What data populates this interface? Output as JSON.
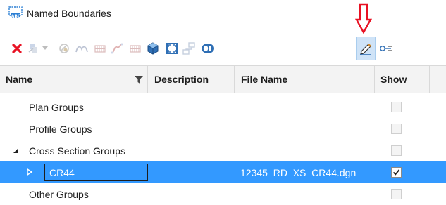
{
  "window": {
    "title": "Named Boundaries",
    "title_icon": "named-boundaries-icon"
  },
  "toolbar": {
    "buttons": [
      {
        "icon": "delete-x-icon",
        "enabled": true,
        "color": "#e81123"
      },
      {
        "icon": "design-stage-icon",
        "enabled": false
      },
      {
        "icon": "dropdown-arrow-icon",
        "enabled": false
      },
      {
        "icon": "clip-volume-icon",
        "enabled": false
      },
      {
        "icon": "profile-shape-icon",
        "enabled": false
      },
      {
        "icon": "grid-lines-icon",
        "enabled": false
      },
      {
        "icon": "curve-icon",
        "enabled": false
      },
      {
        "icon": "grid-lines-2-icon",
        "enabled": false
      },
      {
        "icon": "3d-cube-icon",
        "enabled": true
      },
      {
        "icon": "fit-view-icon",
        "enabled": true
      },
      {
        "icon": "group-hierarchy-icon",
        "enabled": false
      },
      {
        "icon": "properties-icon",
        "enabled": true
      },
      {
        "icon": "pencil-edit-icon",
        "enabled": true,
        "active": true
      },
      {
        "icon": "key-settings-icon",
        "enabled": true
      }
    ],
    "annotation_arrow_color": "#e81123"
  },
  "grid": {
    "columns": [
      {
        "label": "Name",
        "filter_icon": "filter-funnel-icon"
      },
      {
        "label": "Description"
      },
      {
        "label": "File Name"
      },
      {
        "label": "Show"
      }
    ],
    "rows": [
      {
        "name": "Plan Groups",
        "description": "",
        "file_name": "",
        "show": false
      },
      {
        "name": "Profile Groups",
        "description": "",
        "file_name": "",
        "show": false
      },
      {
        "name": "Cross Section Groups",
        "description": "",
        "file_name": "",
        "show": false,
        "expanded": true
      },
      {
        "name": "CR44",
        "description": "",
        "file_name": "12345_RD_XS_CR44.dgn",
        "show": true,
        "selected": true,
        "collapsed": true
      },
      {
        "name": "Other Groups",
        "description": "",
        "file_name": "",
        "show": false
      }
    ],
    "selection_color": "#3399ff"
  }
}
